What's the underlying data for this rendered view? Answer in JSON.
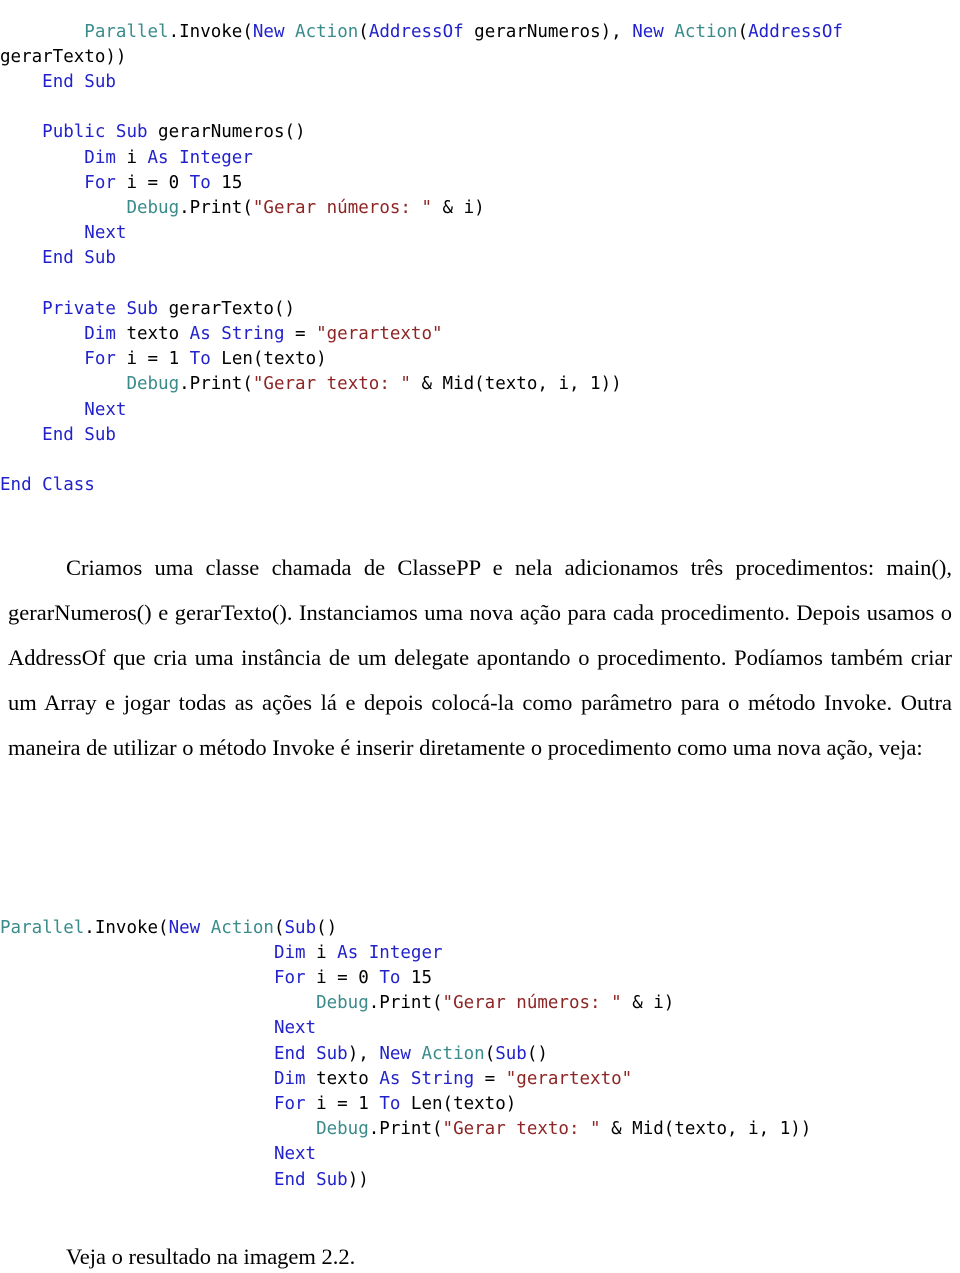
{
  "document": {
    "language": "pt-BR",
    "colors": {
      "keyword": "#2222cc",
      "type": "#3b8b8b",
      "string": "#8e2525",
      "plain": "#000000",
      "background": "#ffffff"
    }
  },
  "code_block_1": {
    "name": "vb-class-code-listing",
    "lines": [
      "        Parallel.Invoke(New Action(AddressOf gerarNumeros), New Action(AddressOf",
      "gerarTexto))",
      "    End Sub",
      "",
      "    Public Sub gerarNumeros()",
      "        Dim i As Integer",
      "        For i = 0 To 15",
      "            Debug.Print(\"Gerar números: \" & i)",
      "        Next",
      "    End Sub",
      "",
      "    Private Sub gerarTexto()",
      "        Dim texto As String = \"gerartexto\"",
      "        For i = 1 To Len(texto)",
      "            Debug.Print(\"Gerar texto: \" & Mid(texto, i, 1))",
      "        Next",
      "    End Sub",
      "",
      "End Class"
    ]
  },
  "paragraph": {
    "text": "Criamos uma classe chamada de ClassePP e nela adicionamos três procedimentos: main(), gerarNumeros() e gerarTexto(). Instanciamos uma nova ação para cada procedimento. Depois usamos o AddressOf que cria uma instância de um delegate apontando o procedimento. Podíamos também criar um Array e jogar todas as ações lá e depois colocá-la como parâmetro para o método Invoke. Outra maneira de utilizar o método Invoke é inserir diretamente o procedimento como uma nova ação, veja:"
  },
  "code_block_2": {
    "name": "vb-lambda-code-listing",
    "lines": [
      "Parallel.Invoke(New Action(Sub()",
      "                          Dim i As Integer",
      "                          For i = 0 To 15",
      "                              Debug.Print(\"Gerar números: \" & i)",
      "                          Next",
      "                          End Sub), New Action(Sub()",
      "                          Dim texto As String = \"gerartexto\"",
      "                          For i = 1 To Len(texto)",
      "                              Debug.Print(\"Gerar texto: \" & Mid(texto, i, 1))",
      "                          Next",
      "                          End Sub))"
    ]
  },
  "closing": {
    "text": "Veja o resultado na imagem 2.2."
  }
}
